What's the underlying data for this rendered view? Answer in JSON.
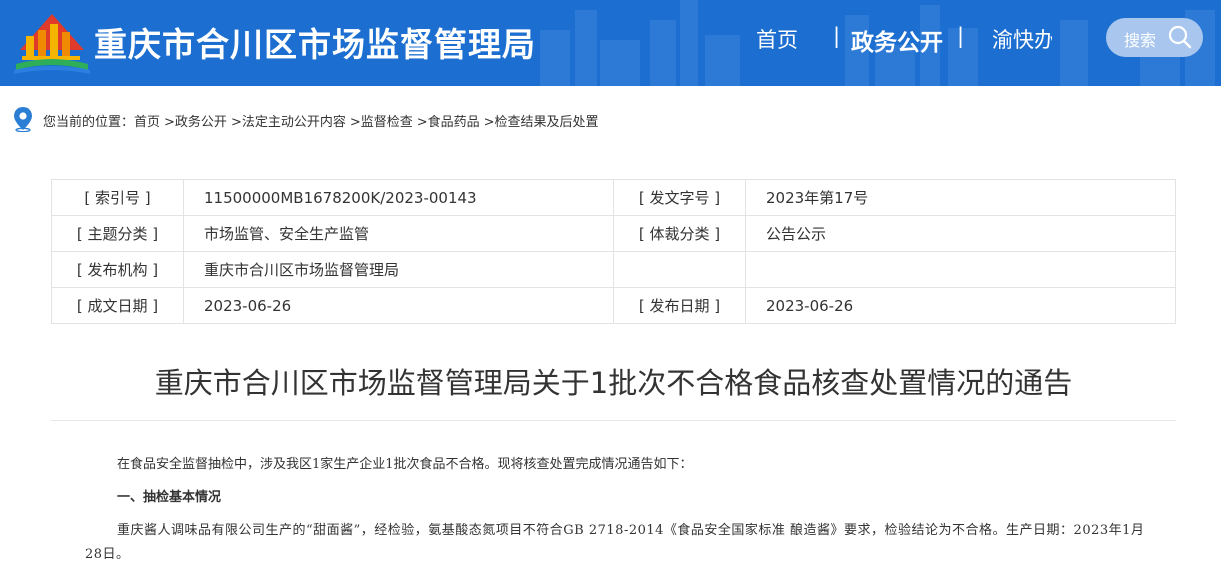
{
  "header": {
    "site_title": "重庆市合川区市场监督管理局",
    "nav": {
      "home": "首页",
      "sep1": "|",
      "gov": "政务公开",
      "sep2": "|",
      "yu": "渝快办"
    },
    "search_label": "搜索",
    "colors": {
      "bar": "#1c6fd0",
      "search_bg": "#a9c7ee"
    }
  },
  "breadcrumb": {
    "prefix": "您当前的位置：",
    "items": [
      "首页",
      " >政务公开",
      " >法定主动公开内容",
      " >监督检查",
      " >食品药品",
      " >检查结果及后处置"
    ]
  },
  "meta": {
    "rows": [
      {
        "k1": "[ 索引号 ]",
        "v1": "11500000MB1678200K/2023-00143",
        "k2": "[ 发文字号 ]",
        "v2": "2023年第17号"
      },
      {
        "k1": "[ 主题分类 ]",
        "v1": "市场监管、安全生产监管",
        "k2": "[ 体裁分类 ]",
        "v2": "公告公示"
      },
      {
        "k1": "[ 发布机构 ]",
        "v1": "重庆市合川区市场监督管理局",
        "k2": "",
        "v2": ""
      },
      {
        "k1": "[ 成文日期 ]",
        "v1": "2023-06-26",
        "k2": "[ 发布日期 ]",
        "v2": "2023-06-26"
      }
    ]
  },
  "article": {
    "title": "重庆市合川区市场监督管理局关于1批次不合格食品核查处置情况的通告",
    "intro": "在食品安全监督抽检中，涉及我区1家生产企业1批次食品不合格。现将核查处置完成情况通告如下：",
    "section1": "一、抽检基本情况",
    "body1": "重庆酱人调味品有限公司生产的“甜面酱”，经检验，氨基酸态氮项目不符合GB 2718-2014《食品安全国家标准 酿造酱》要求，检验结论为不合格。生产日期：2023年1月28日。"
  }
}
